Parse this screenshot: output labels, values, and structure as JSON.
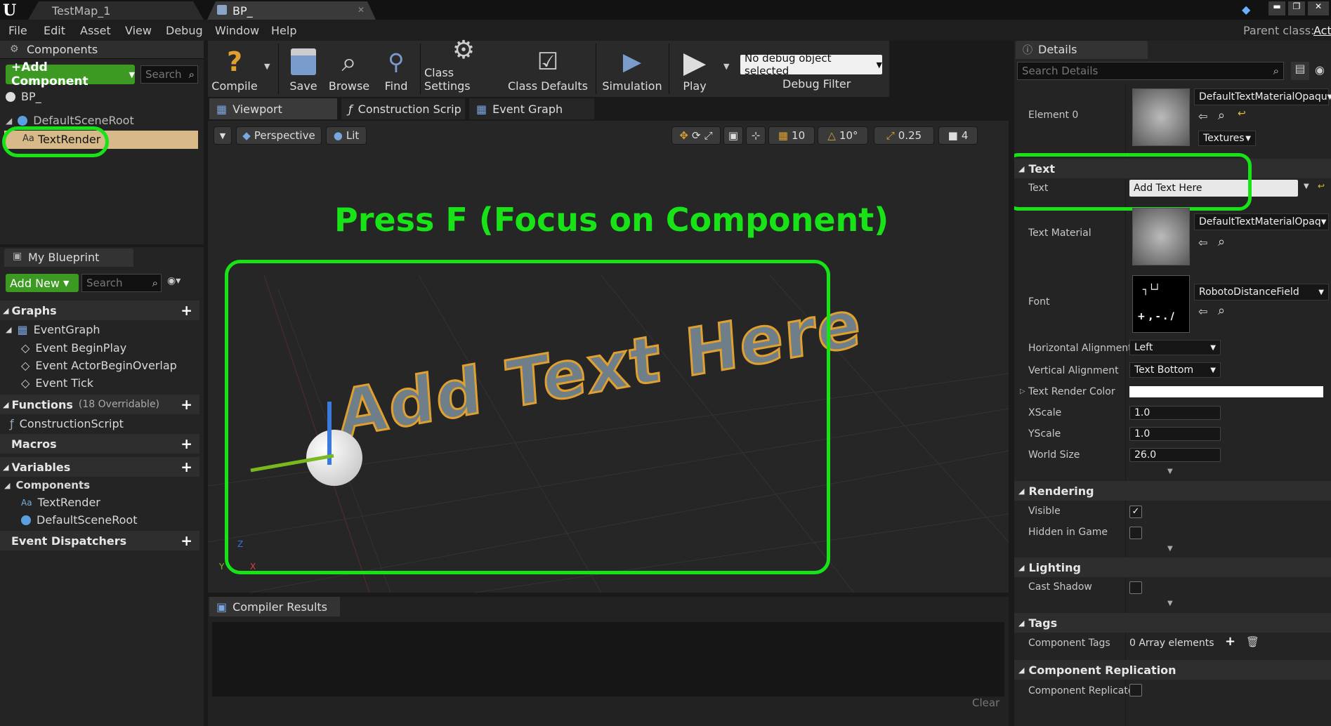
{
  "window": {
    "doc_tabs": [
      "TestMap_1",
      "BP_"
    ],
    "parent_class_label": "Parent class:",
    "parent_class_value": "Act"
  },
  "menu": [
    "File",
    "Edit",
    "Asset",
    "View",
    "Debug",
    "Window",
    "Help"
  ],
  "components_panel": {
    "title": "Components",
    "add_button": "+Add Component",
    "search_placeholder": "Search",
    "root_item": "BP_",
    "scene_root": "DefaultSceneRoot",
    "text_render": "TextRender"
  },
  "toolbar": {
    "compile": "Compile",
    "save": "Save",
    "browse": "Browse",
    "find": "Find",
    "class_settings": "Class Settings",
    "class_defaults": "Class Defaults",
    "simulation": "Simulation",
    "play": "Play",
    "debug_select": "No debug object selected",
    "debug_filter": "Debug Filter"
  },
  "editor_tabs": [
    "Viewport",
    "Construction Scrip",
    "Event Graph"
  ],
  "viewport": {
    "perspective": "Perspective",
    "lit": "Lit",
    "grid_snap": "10",
    "rot_snap": "10°",
    "scale_snap": "0.25",
    "cam_speed": "4",
    "annotation": "Press F (Focus on Component)",
    "text3d": "Add Text Here",
    "axis_y": "Y",
    "axis_x": "X",
    "axis_z": "Z"
  },
  "my_blueprint": {
    "title": "My Blueprint",
    "add_new": "Add New",
    "search_placeholder": "Search",
    "graphs": "Graphs",
    "event_graph": "EventGraph",
    "events": [
      "Event BeginPlay",
      "Event ActorBeginOverlap",
      "Event Tick"
    ],
    "functions": "Functions",
    "functions_note": "(18 Overridable)",
    "construction_script": "ConstructionScript",
    "macros": "Macros",
    "variables": "Variables",
    "components": "Components",
    "var_components": [
      "TextRender",
      "DefaultSceneRoot"
    ],
    "event_dispatchers": "Event Dispatchers"
  },
  "compiler": {
    "title": "Compiler Results",
    "clear": "Clear"
  },
  "details": {
    "title": "Details",
    "search_placeholder": "Search Details",
    "element0_label": "Element 0",
    "element0_value": "DefaultTextMaterialOpaqu",
    "textures_btn": "Textures",
    "text_section": "Text",
    "text_label": "Text",
    "text_value": "Add Text Here",
    "text_material_label": "Text Material",
    "text_material_value": "DefaultTextMaterialOpaq",
    "font_label": "Font",
    "font_value": "RobotoDistanceField",
    "font_preview_top": "┐└┘",
    "font_preview_bottom": "+ , - . /",
    "h_align_label": "Horizontal Alignment",
    "h_align_value": "Left",
    "v_align_label": "Vertical Alignment",
    "v_align_value": "Text Bottom",
    "color_label": "Text Render Color",
    "text_color": "#ffffff",
    "xscale_label": "XScale",
    "xscale_value": "1.0",
    "yscale_label": "YScale",
    "yscale_value": "1.0",
    "world_size_label": "World Size",
    "world_size_value": "26.0",
    "rendering_section": "Rendering",
    "visible_label": "Visible",
    "hidden_label": "Hidden in Game",
    "lighting_section": "Lighting",
    "cast_shadow_label": "Cast Shadow",
    "tags_section": "Tags",
    "component_tags_label": "Component Tags",
    "component_tags_value": "0 Array elements",
    "replication_section": "Component Replication",
    "replicates_label": "Component Replicate"
  },
  "colors": {
    "accent_green": "#17e317",
    "add_button": "#3c9a23",
    "selected_row": "#d8b98a",
    "text_highlight": "#e0a030"
  }
}
